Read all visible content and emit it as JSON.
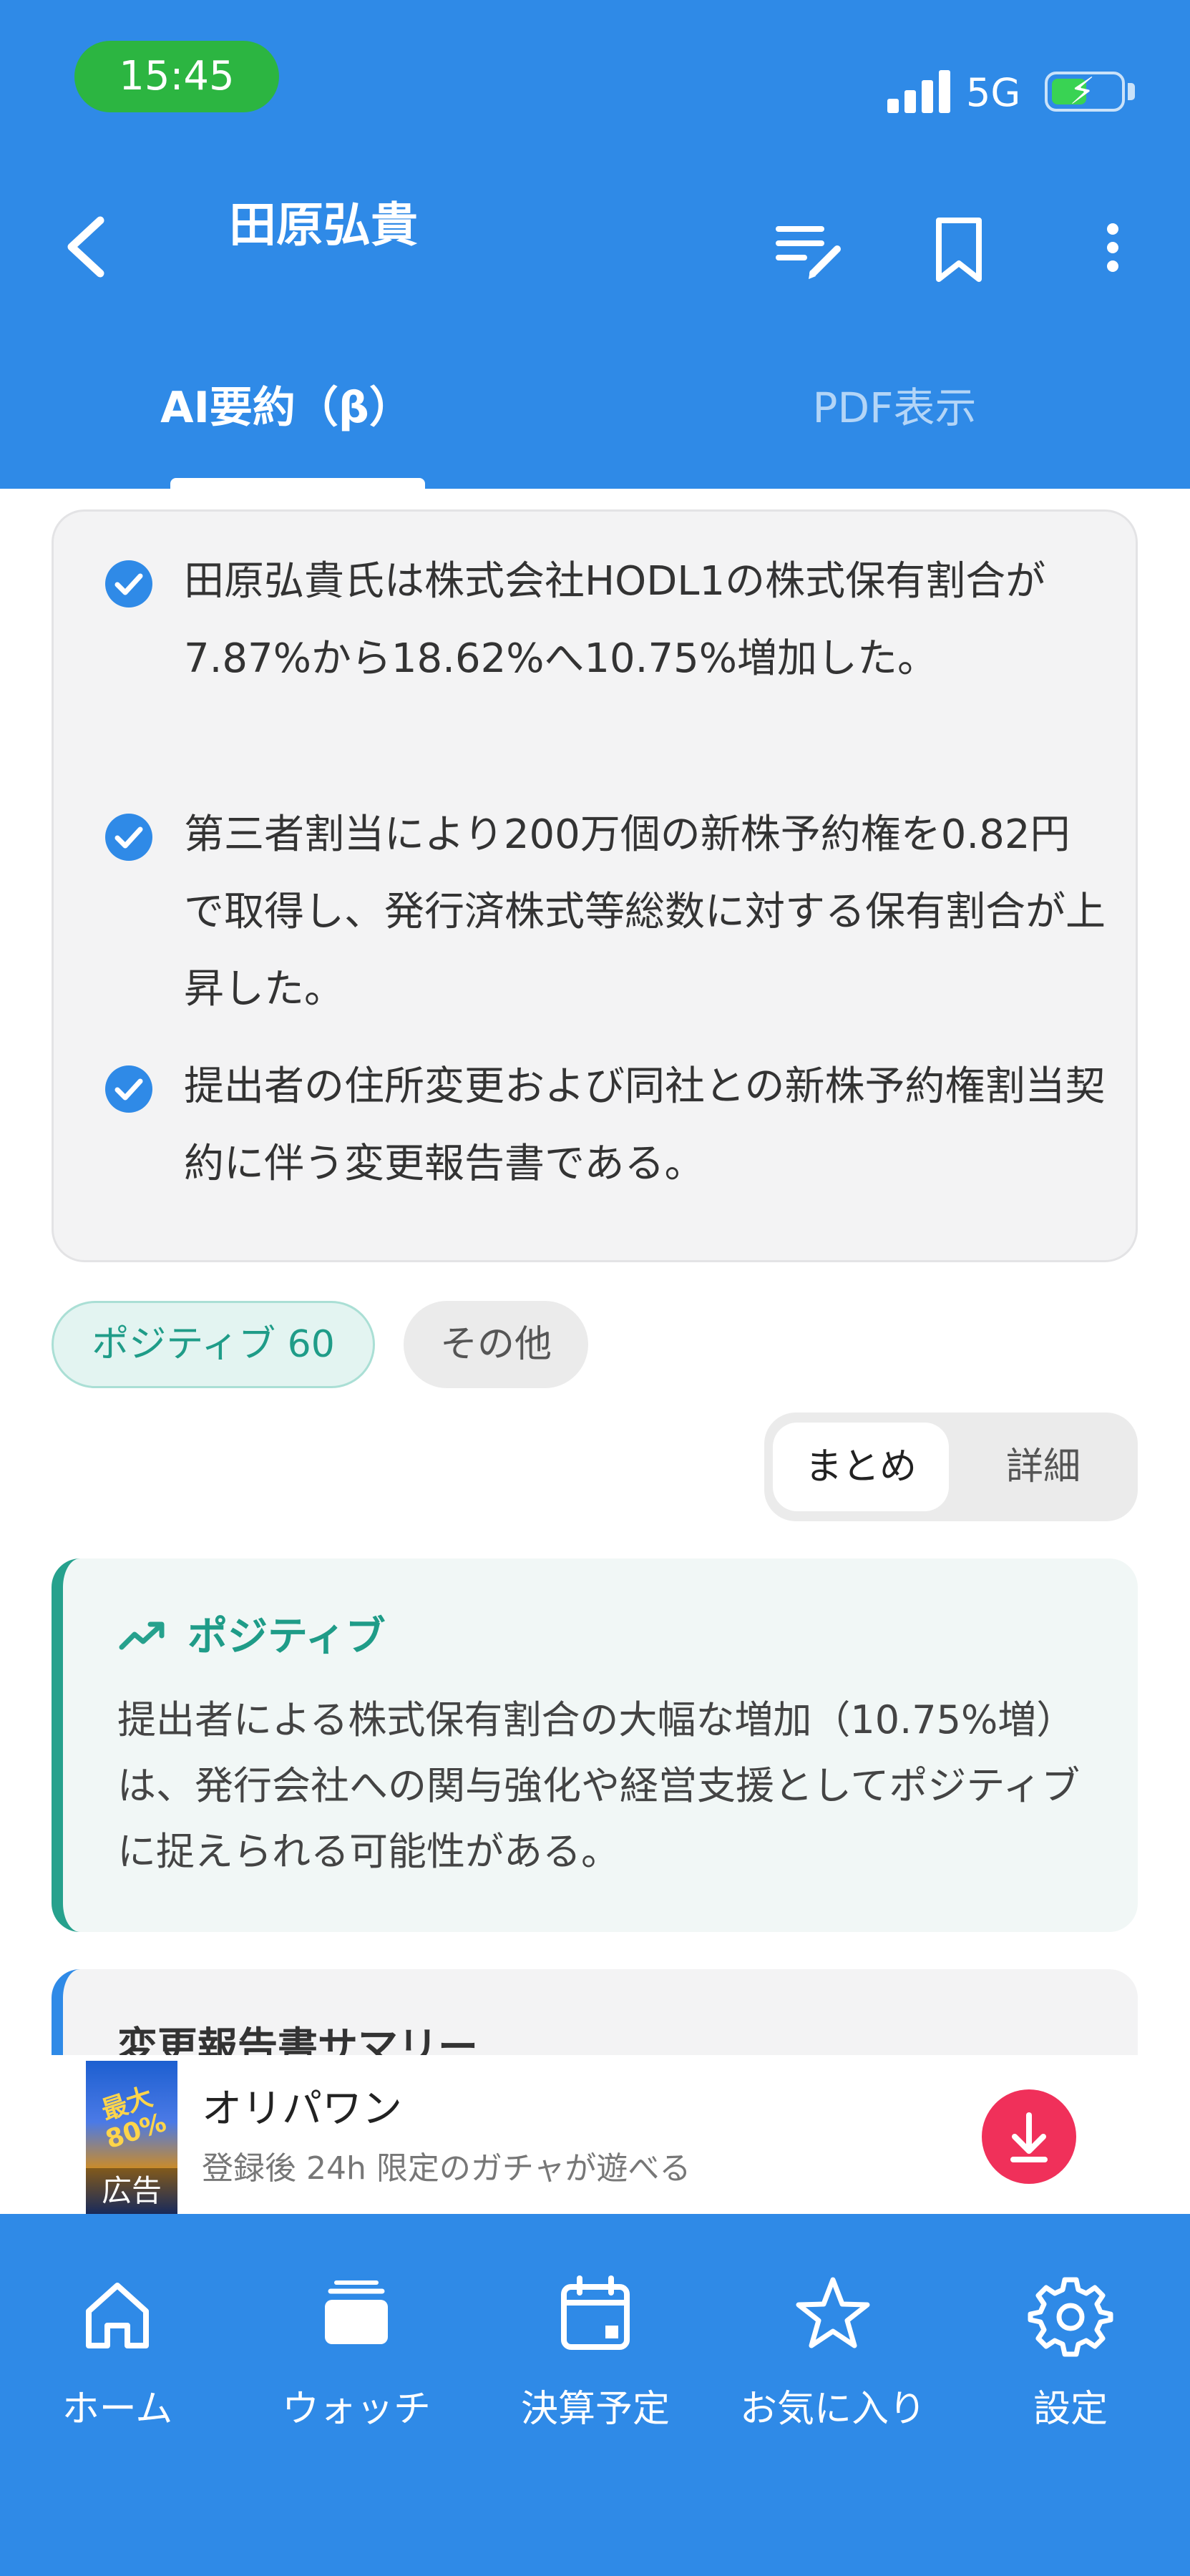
{
  "status_bar": {
    "time": "15:45",
    "network": "5G"
  },
  "header": {
    "title": "田原弘貴",
    "back_icon": "chevron-left-icon",
    "actions": [
      "edit-list-icon",
      "bookmark-icon",
      "more-vertical-icon"
    ],
    "tabs": [
      {
        "label": "AI要約（β）",
        "active": true
      },
      {
        "label": "PDF表示",
        "active": false
      }
    ]
  },
  "summary": {
    "bullets": [
      {
        "text": "田原弘貴氏は株式会社HODL1の株式保有割合が7.87%から18.62%へ10.75%増加した。"
      },
      {
        "text": "第三者割当により200万個の新株予約権を0.82円で取得し、発行済株式等総数に対する保有割合が上昇した。"
      },
      {
        "text": "提出者の住所変更および同社との新株予約権割当契約に伴う変更報告書である。"
      }
    ]
  },
  "tags": {
    "sentiment": "ポジティブ 60",
    "category": "その他"
  },
  "view_toggle": {
    "options": [
      "まとめ",
      "詳細"
    ],
    "selected": "まとめ"
  },
  "positive_card": {
    "heading": "ポジティブ",
    "body": "提出者による株式保有割合の大幅な増加（10.75%増）は、発行会社への関与強化や経営支援としてポジティブに捉えられる可能性がある。"
  },
  "next_card": {
    "heading": "変更報告書サマリー"
  },
  "ad": {
    "title": "オリパワン",
    "subtitle": "登録後 24h 限定のガチャが遊べる",
    "label": "広告",
    "promo": "最大80%"
  },
  "bottom_nav": [
    {
      "label": "ホーム",
      "icon": "home-icon"
    },
    {
      "label": "ウォッチ",
      "icon": "watch-stack-icon"
    },
    {
      "label": "決算予定",
      "icon": "calendar-icon"
    },
    {
      "label": "お気に入り",
      "icon": "star-icon"
    },
    {
      "label": "設定",
      "icon": "gear-icon"
    }
  ],
  "colors": {
    "primary": "#2f8ae7",
    "positive": "#26a18d",
    "ad_button": "#f0305a"
  }
}
